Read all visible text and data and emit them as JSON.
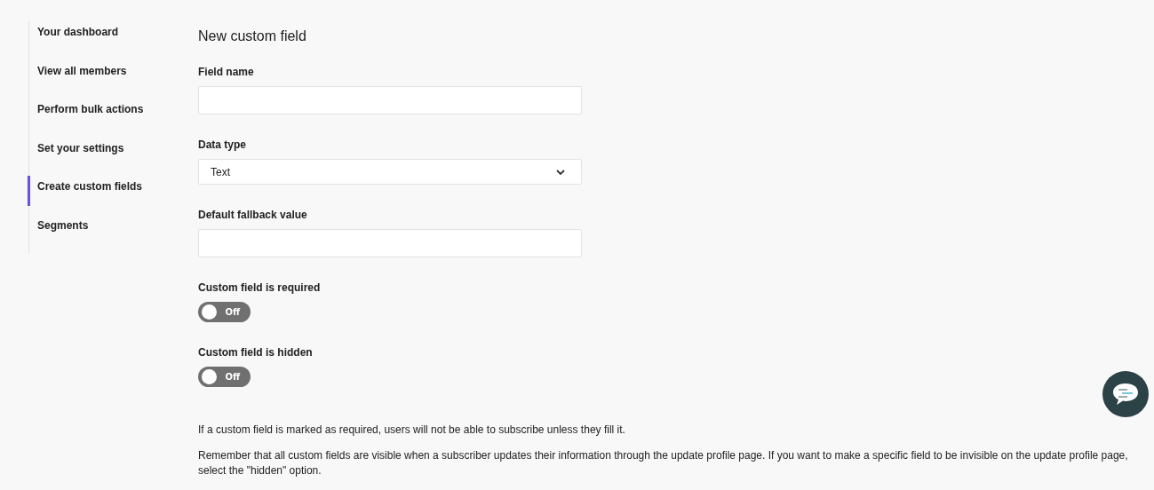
{
  "sidebar": {
    "items": [
      {
        "label": "Your dashboard",
        "selected": false
      },
      {
        "label": "View all members",
        "selected": false
      },
      {
        "label": "Perform bulk actions",
        "selected": false
      },
      {
        "label": "Set your settings",
        "selected": false
      },
      {
        "label": "Create custom fields",
        "selected": true
      },
      {
        "label": "Segments",
        "selected": false
      }
    ]
  },
  "form": {
    "title": "New custom field",
    "fields": [
      {
        "kind": "input",
        "label": "Field name"
      },
      {
        "kind": "select",
        "label": "Data type",
        "value": "Text"
      },
      {
        "kind": "input",
        "label": "Default fallback value"
      },
      {
        "kind": "toggle",
        "label": "Custom field is required",
        "on": false,
        "state_label": "Off"
      },
      {
        "kind": "toggle",
        "label": "Custom field is hidden",
        "on": false,
        "state_label": "Off"
      }
    ],
    "notes": [
      "If a custom field is marked as required, users will not be able to subscribe unless they fill it.",
      "Remember that all custom fields are visible when a subscriber updates their information through the update profile page. If you want to make a specific field to be invisible on the update profile page, select the \"hidden\" option."
    ]
  }
}
